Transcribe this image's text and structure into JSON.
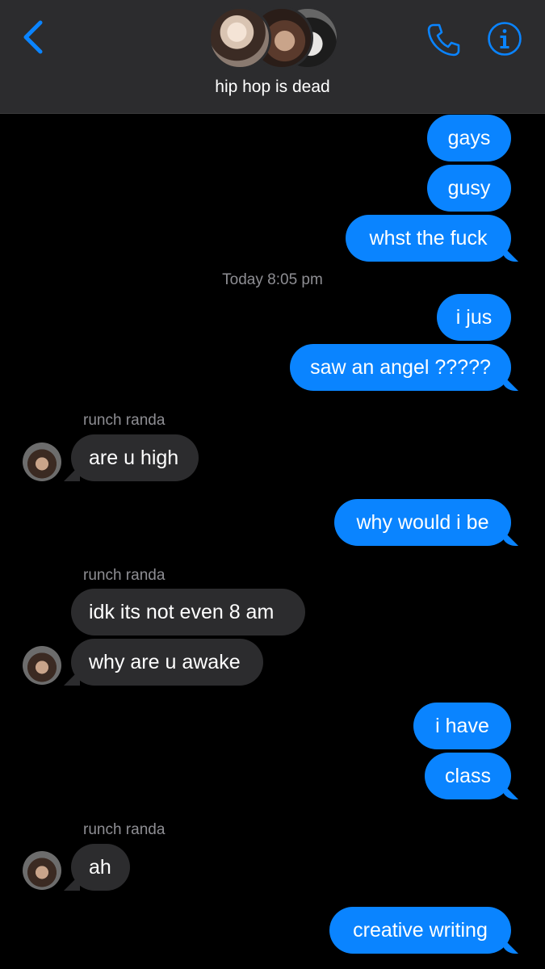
{
  "header": {
    "group_name": "hip hop is dead",
    "accent_color": "#0a84ff",
    "icons": [
      "chevron-left-icon",
      "phone-icon",
      "info-icon"
    ]
  },
  "timestamp": "Today 8:05 pm",
  "messages": [
    {
      "from": "me",
      "text": "gays"
    },
    {
      "from": "me",
      "text": "gusy"
    },
    {
      "from": "me",
      "text": "whst the fuck"
    },
    {
      "from": "me",
      "text": "i jus"
    },
    {
      "from": "me",
      "text": "saw an angel ?????"
    },
    {
      "from": "runch randa",
      "sender_label": "runch randa",
      "text": "are u high"
    },
    {
      "from": "me",
      "text": "why would i be"
    },
    {
      "from": "runch randa",
      "sender_label": "runch randa",
      "text": "idk its not even 8 am"
    },
    {
      "from": "runch randa",
      "text": "why are u awake"
    },
    {
      "from": "me",
      "text": "i have"
    },
    {
      "from": "me",
      "text": "class"
    },
    {
      "from": "runch randa",
      "sender_label": "runch randa",
      "text": "ah"
    },
    {
      "from": "me",
      "text": "creative writing"
    }
  ]
}
